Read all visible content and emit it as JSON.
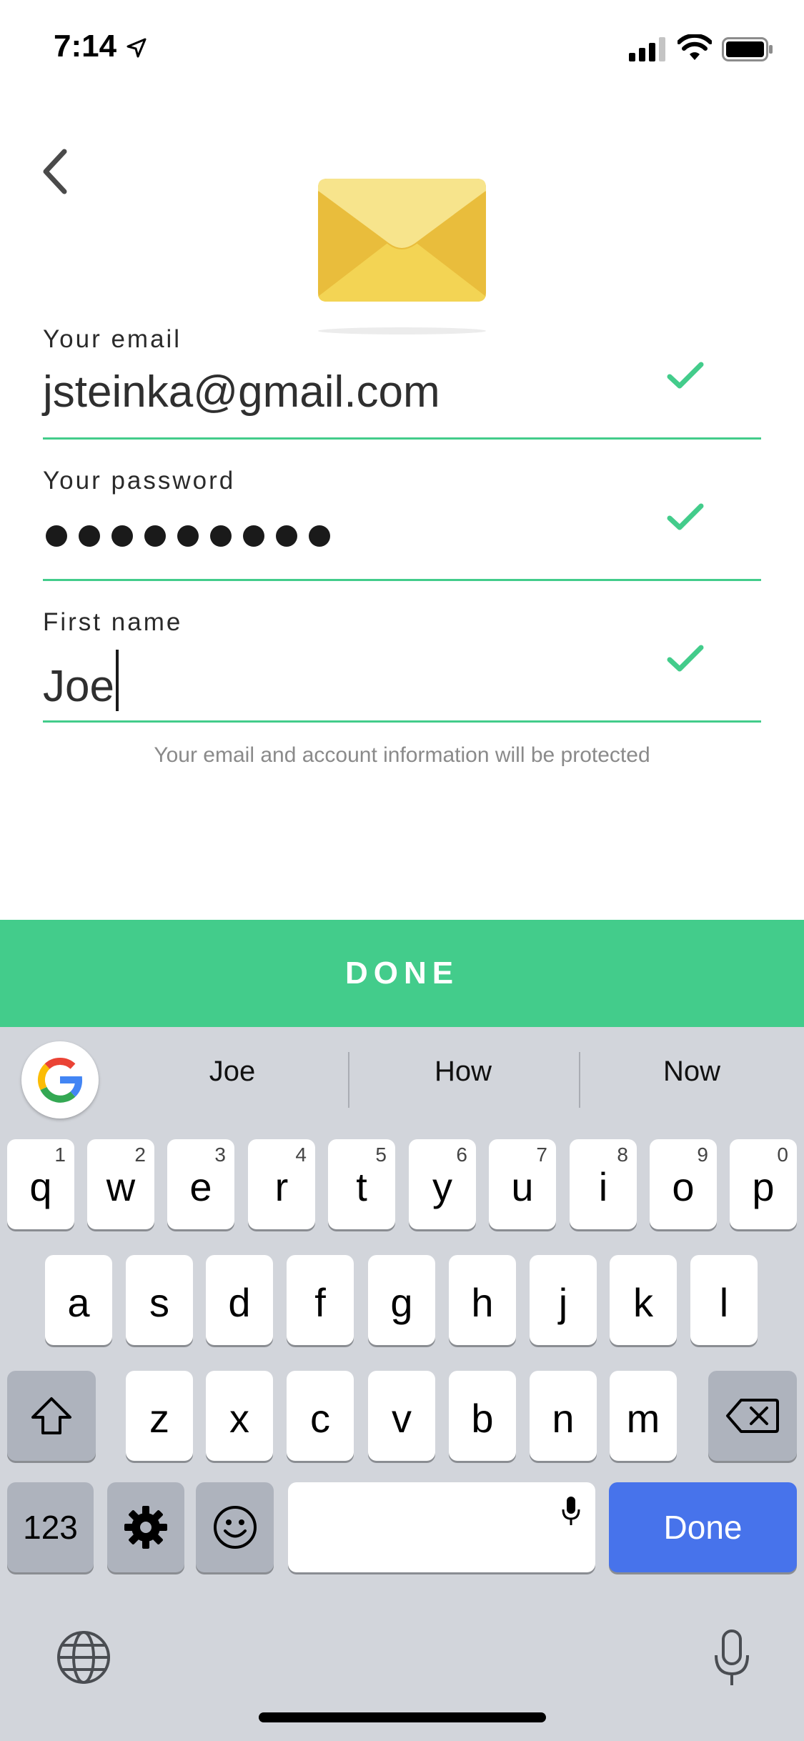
{
  "status": {
    "time": "7:14"
  },
  "form": {
    "email_label": "Your email",
    "email_value": "jsteinka@gmail.com",
    "password_label": "Your password",
    "password_value": "•••••••••",
    "password_length": 9,
    "first_name_label": "First name",
    "first_name_value": "Joe",
    "helper_text": "Your email and account information will be protected"
  },
  "done_bar": {
    "label": "DONE"
  },
  "keyboard": {
    "suggestions": [
      "Joe",
      "How",
      "Now"
    ],
    "row1": [
      {
        "key": "q",
        "num": "1"
      },
      {
        "key": "w",
        "num": "2"
      },
      {
        "key": "e",
        "num": "3"
      },
      {
        "key": "r",
        "num": "4"
      },
      {
        "key": "t",
        "num": "5"
      },
      {
        "key": "y",
        "num": "6"
      },
      {
        "key": "u",
        "num": "7"
      },
      {
        "key": "i",
        "num": "8"
      },
      {
        "key": "o",
        "num": "9"
      },
      {
        "key": "p",
        "num": "0"
      }
    ],
    "row2": [
      "a",
      "s",
      "d",
      "f",
      "g",
      "h",
      "j",
      "k",
      "l"
    ],
    "row3": [
      "z",
      "x",
      "c",
      "v",
      "b",
      "n",
      "m"
    ],
    "numbers_key": "123",
    "done_key": "Done"
  },
  "colors": {
    "accent_green": "#43cc8b",
    "keyboard_bg": "#d2d5db",
    "done_key_blue": "#4773eb"
  }
}
